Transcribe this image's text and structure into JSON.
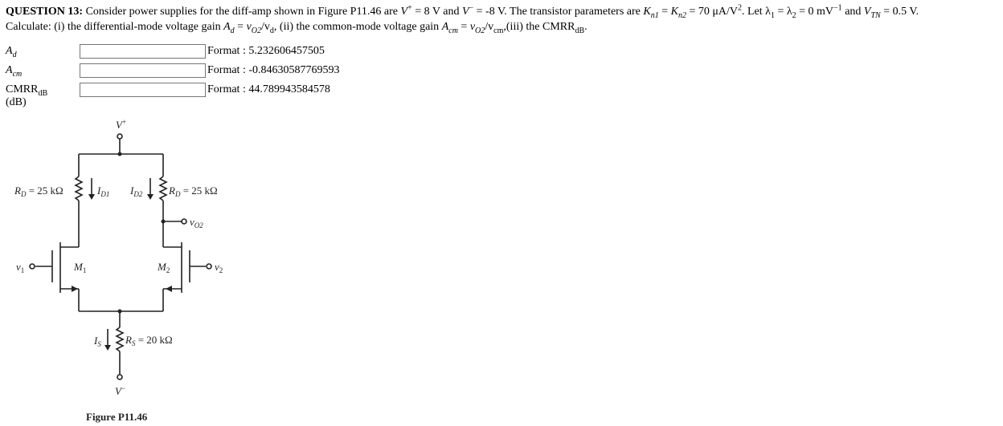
{
  "question": {
    "number_label": "QUESTION 13:",
    "text_line1_a": " Consider power supplies for the diff-amp shown in Figure P11.46 are ",
    "vplus": "V",
    "vplus_sup": "+",
    "vplus_val": " = 8 V and ",
    "vminus": "V",
    "vminus_sup": "−",
    "vminus_val": " = -8 V. The transistor parameters are ",
    "kn1": "K",
    "kn1_sub": "n1",
    "kn_eq": " = ",
    "kn2": "K",
    "kn2_sub": "n2",
    "kn_val": " = 70 μA/V",
    "kn_val_sup": "2",
    "lambda_text": ". Let λ",
    "lambda1_sub": "1",
    "lambda_eq": " = λ",
    "lambda2_sub": "2",
    "lambda_val": " = 0 mV",
    "lambda_val_sup": "−1",
    "vtn_pre": " and ",
    "vtn": "V",
    "vtn_sub": "TN",
    "vtn_val": " = 0.5 V.",
    "line2_a": "Calculate: (i) the differential-mode voltage gain ",
    "ad": "A",
    "ad_sub": "d",
    "ad_eq": " = ",
    "vo2": "v",
    "vo2_sub": "O2",
    "slash_vd": "/v",
    "vd_sub": "d",
    "line2_b": ", (ii) the common-mode voltage gain ",
    "acm": "A",
    "acm_sub": "cm",
    "acm_eq": " = ",
    "slash_vcm": "/v",
    "vcm_sub": "cm",
    "line2_c": ",(iii) the CMRR",
    "cmrr_sub": "dB",
    "line2_end": "."
  },
  "answers": [
    {
      "label": "A",
      "label_sub": "d",
      "label_suffix": "",
      "value": "",
      "format": "Format : 5.232606457505"
    },
    {
      "label": "A",
      "label_sub": "cm",
      "label_suffix": "",
      "value": "",
      "format": "Format : -0.84630587769593"
    },
    {
      "label": "CMRR",
      "label_sub": "dB",
      "label_suffix": " (dB)",
      "value": "",
      "format": "Format : 44.789943584578"
    }
  ],
  "figure": {
    "vplus_label": "V",
    "vplus_sup": "+",
    "rd_left": "R",
    "rd_left_sub": "D",
    "rd_left_val": " = 25 kΩ",
    "id1": "I",
    "id1_sub": "D1",
    "id2": "I",
    "id2_sub": "D2",
    "rd_right": "R",
    "rd_right_sub": "D",
    "rd_right_val": " = 25 kΩ",
    "vo2": "v",
    "vo2_sub": "O2",
    "v1": "v",
    "v1_sub": "1",
    "v2": "v",
    "v2_sub": "2",
    "m1": "M",
    "m1_sub": "1",
    "m2": "M",
    "m2_sub": "2",
    "is": "I",
    "is_sub": "S",
    "rs": "R",
    "rs_sub": "S",
    "rs_val": " = 20 kΩ",
    "vminus_label": "V",
    "vminus_sup": "−",
    "caption": "Figure P11.46"
  }
}
